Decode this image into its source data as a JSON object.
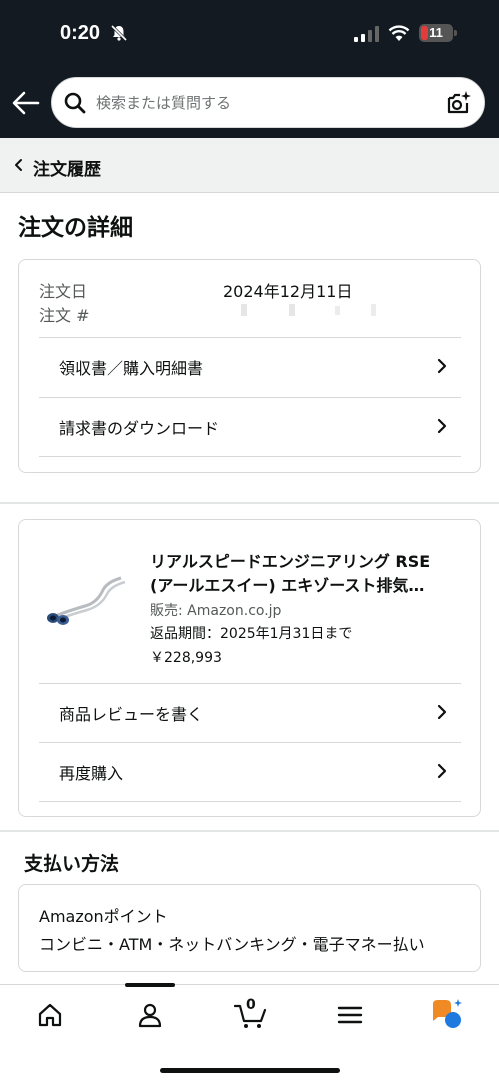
{
  "status_bar": {
    "time": "0:20",
    "battery": "11"
  },
  "search": {
    "placeholder": "検索または質問する"
  },
  "breadcrumb": {
    "label": "注文履歴"
  },
  "page_title": "注文の詳細",
  "order": {
    "date_label": "注文日",
    "date_value": "2024年12月11日",
    "number_label": "注文 #",
    "links": [
      "領収書／購入明細書",
      "請求書のダウンロード"
    ]
  },
  "product": {
    "title_line1": "リアルスピードエンジニアリング RSE",
    "title_line2": "(アールエスイー) エキゾースト排気…",
    "seller": "販売: Amazon.co.jp",
    "return_period": "返品期間：2025年1月31日まで",
    "price": "￥228,993",
    "actions": [
      "商品レビューを書く",
      "再度購入"
    ]
  },
  "payment": {
    "title": "支払い方法",
    "line1": "Amazonポイント",
    "line2": "コンビニ・ATM・ネットバンキング・電子マネー払い"
  },
  "bottom_nav": {
    "cart_count": "0",
    "items": [
      "home-icon",
      "account-icon",
      "cart-icon",
      "menu-icon",
      "rufus-icon"
    ]
  },
  "colors": {
    "header_bg": "#131a22",
    "crumb_bg": "#f0f2f2",
    "border": "#d5d9d9",
    "rufus_orange": "#f08a24",
    "rufus_blue": "#1f7ae0"
  }
}
